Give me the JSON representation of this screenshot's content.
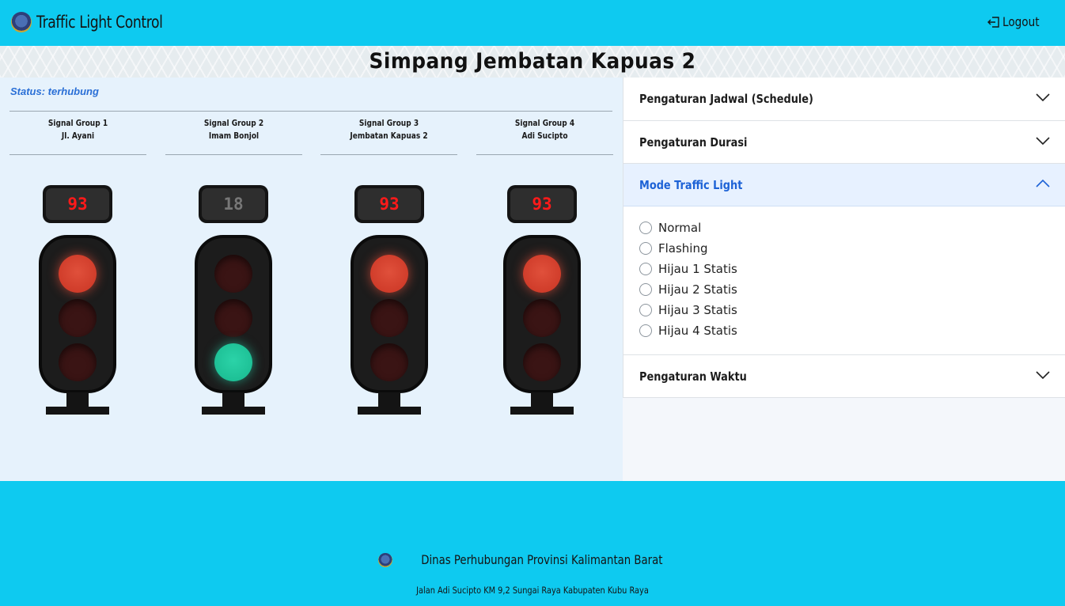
{
  "header": {
    "app_title": "Traffic Light Control",
    "logout_label": "Logout",
    "logo_icon": "dishub-logo-icon",
    "logout_icon": "logout-arrow-icon"
  },
  "page": {
    "title": "Simpang Jembatan Kapuas 2"
  },
  "status": {
    "text": "Status: terhubung",
    "color": "#2a6fd6"
  },
  "signal_groups": [
    {
      "name": "Signal Group 1",
      "street": "Jl. Ayani",
      "counter": "93",
      "counter_color": "red",
      "active_lamp": "red"
    },
    {
      "name": "Signal Group 2",
      "street": "Imam Bonjol",
      "counter": "18",
      "counter_color": "gray",
      "active_lamp": "green"
    },
    {
      "name": "Signal Group 3",
      "street": "Jembatan Kapuas 2",
      "counter": "93",
      "counter_color": "red",
      "active_lamp": "red"
    },
    {
      "name": "Signal Group 4",
      "street": "Adi Sucipto",
      "counter": "93",
      "counter_color": "red",
      "active_lamp": "red"
    }
  ],
  "accordion": {
    "schedule_label": "Pengaturan Jadwal (Schedule)",
    "duration_label": "Pengaturan Durasi",
    "mode_label": "Mode Traffic Light",
    "time_label": "Pengaturan Waktu",
    "mode_expanded": true,
    "mode_options": [
      "Normal",
      "Flashing",
      "Hijau 1 Statis",
      "Hijau 2 Statis",
      "Hijau 3 Statis",
      "Hijau 4 Statis"
    ],
    "mode_selected": null
  },
  "footer": {
    "org_name": "Dinas Perhubungan Provinsi Kalimantan Barat",
    "address": "Jalan Adi Sucipto KM 9,2 Sungai Raya Kabupaten Kubu Raya"
  },
  "colors": {
    "header_bg": "#0ecaf0",
    "lamp_red": "#d8412e",
    "lamp_green": "#20c79c",
    "counter_red": "#ff1a1a",
    "accent_blue": "#1d62d6"
  }
}
